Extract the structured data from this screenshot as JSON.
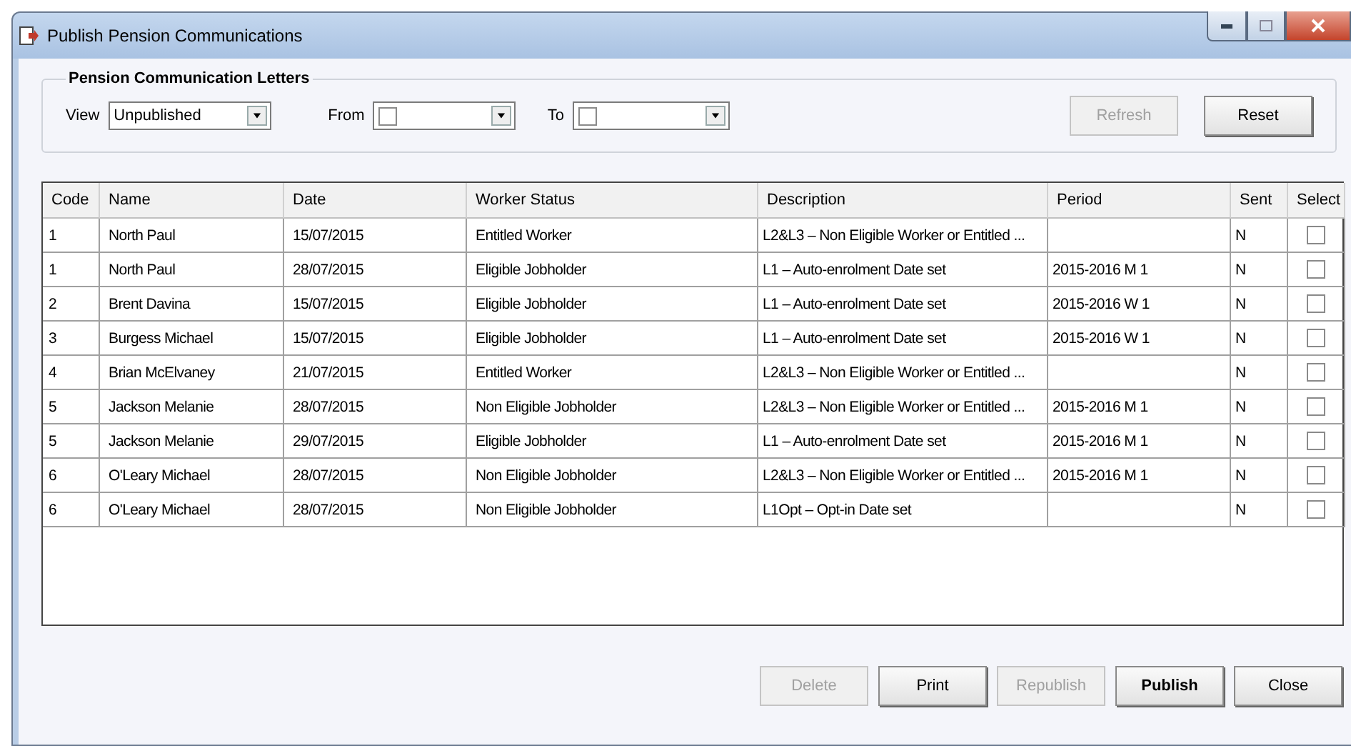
{
  "window": {
    "title": "Publish Pension Communications"
  },
  "filter": {
    "title": "Pension Communication Letters",
    "view_label": "View",
    "view_value": "Unpublished",
    "from_label": "From",
    "to_label": "To",
    "buttons": [
      {
        "label": "Refresh",
        "disabled": true
      },
      {
        "label": "Reset",
        "disabled": false
      }
    ]
  },
  "table": {
    "columns": [
      "Code",
      "Name",
      "Date",
      "Worker Status",
      "Description",
      "Period",
      "Sent",
      "Select"
    ],
    "rows": [
      {
        "cells": [
          "1",
          "North Paul",
          "15/07/2015",
          "Entitled Worker",
          "L2&L3 – Non Eligible Worker or Entitled ...",
          "",
          "N"
        ],
        "checked": false
      },
      {
        "cells": [
          "1",
          "North Paul",
          "28/07/2015",
          "Eligible Jobholder",
          "L1 – Auto-enrolment Date set",
          "2015-2016 M 1",
          "N"
        ],
        "checked": false
      },
      {
        "cells": [
          "2",
          "Brent Davina",
          "15/07/2015",
          "Eligible Jobholder",
          "L1 – Auto-enrolment Date set",
          "2015-2016 W 1",
          "N"
        ],
        "checked": false
      },
      {
        "cells": [
          "3",
          "Burgess Michael",
          "15/07/2015",
          "Eligible Jobholder",
          "L1 – Auto-enrolment Date set",
          "2015-2016 W 1",
          "N"
        ],
        "checked": false
      },
      {
        "cells": [
          "4",
          "Brian McElvaney",
          "21/07/2015",
          "Entitled Worker",
          "L2&L3 – Non Eligible Worker or Entitled ...",
          "",
          "N"
        ],
        "checked": false
      },
      {
        "cells": [
          "5",
          "Jackson Melanie",
          "28/07/2015",
          "Non Eligible Jobholder",
          "L2&L3 – Non Eligible Worker or Entitled ...",
          "2015-2016 M 1",
          "N"
        ],
        "checked": false
      },
      {
        "cells": [
          "5",
          "Jackson Melanie",
          "29/07/2015",
          "Eligible Jobholder",
          "L1 – Auto-enrolment Date set",
          "2015-2016 M 1",
          "N"
        ],
        "checked": false
      },
      {
        "cells": [
          "6",
          "O'Leary Michael",
          "28/07/2015",
          "Non Eligible Jobholder",
          "L2&L3 – Non Eligible Worker or Entitled ...",
          "2015-2016 M 1",
          "N"
        ],
        "checked": false
      },
      {
        "cells": [
          "6",
          "O'Leary Michael",
          "28/07/2015",
          "Non Eligible Jobholder",
          "L1Opt – Opt-in Date set",
          "",
          "N"
        ],
        "checked": false
      }
    ]
  },
  "buttons": [
    {
      "label": "Delete",
      "disabled": true,
      "default": false
    },
    {
      "label": "Print",
      "disabled": false,
      "default": false
    },
    {
      "label": "Republish",
      "disabled": true,
      "default": false
    },
    {
      "label": "Publish",
      "disabled": false,
      "default": true
    },
    {
      "label": "Close",
      "disabled": false,
      "default": false
    }
  ]
}
